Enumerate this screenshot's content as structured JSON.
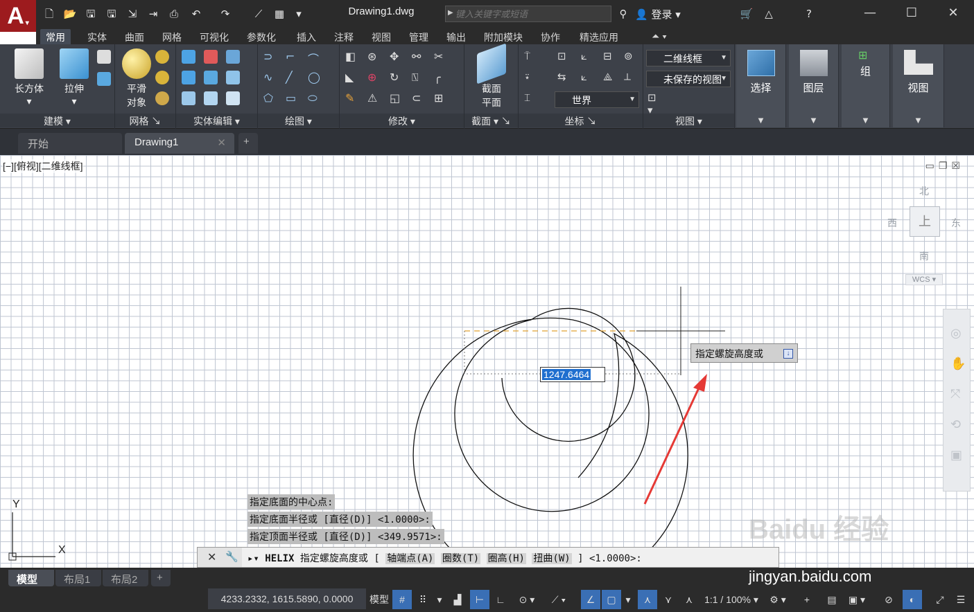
{
  "app": {
    "logo_letter": "A",
    "document_title": "Drawing1.dwg",
    "search_placeholder": "键入关键字或短语",
    "login_label": "登录"
  },
  "ribbon": {
    "tabs": [
      "常用",
      "实体",
      "曲面",
      "网格",
      "可视化",
      "参数化",
      "插入",
      "注释",
      "视图",
      "管理",
      "输出",
      "附加模块",
      "协作",
      "精选应用"
    ],
    "active_tab": "常用",
    "groups": {
      "modeling": {
        "label": "建模",
        "box": "长方体",
        "extrude": "拉伸"
      },
      "mesh": {
        "label": "网格",
        "smooth_line1": "平滑",
        "smooth_line2": "对象"
      },
      "solid_edit": {
        "label": "实体编辑"
      },
      "draw": {
        "label": "绘图"
      },
      "modify": {
        "label": "修改"
      },
      "section": {
        "label": "截面",
        "plane_line1": "截面",
        "plane_line2": "平面"
      },
      "coordinates": {
        "label": "坐标",
        "ucs_combo": "世界"
      },
      "view": {
        "label": "视图",
        "visual_style": "二维线框",
        "saved_view": "未保存的视图"
      },
      "select": {
        "label": "选择"
      },
      "layers": {
        "label": "图层"
      },
      "groups": {
        "label": "组"
      },
      "view_panel": {
        "label": "视图"
      }
    }
  },
  "file_tabs": {
    "start": "开始",
    "drawing": "Drawing1",
    "add": "+"
  },
  "drawing": {
    "viewport_label": "[−][俯视][二维线框]",
    "dynamic_input_value": "1247.6464",
    "tooltip": "指定螺旋高度或",
    "ucs_y": "Y",
    "ucs_x": "X"
  },
  "history": [
    "指定底面的中心点:",
    "指定底面半径或 [直径(D)] <1.0000>:",
    "指定顶面半径或 [直径(D)] <349.9571>:"
  ],
  "command": {
    "name": "HELIX",
    "prompt": "指定螺旋高度或 [",
    "options": [
      "轴端点(A)",
      "圈数(T)",
      "圈高(H)",
      "扭曲(W)"
    ],
    "suffix": "] <1.0000>:"
  },
  "viewcube": {
    "north": "北",
    "south": "南",
    "east": "东",
    "west": "西",
    "top": "上",
    "wcs": "WCS"
  },
  "layout_tabs": [
    "模型",
    "布局1",
    "布局2"
  ],
  "status": {
    "coordinates": "4233.2332, 1615.5890, 0.0000",
    "model": "模型",
    "scale": "1:1 / 100%"
  },
  "watermark": {
    "brand": "Baidu 经验",
    "url": "jingyan.baidu.com"
  },
  "colors": {
    "accent": "#3a6fb5",
    "logo": "#9d1b1e",
    "arrow": "#e53935"
  }
}
